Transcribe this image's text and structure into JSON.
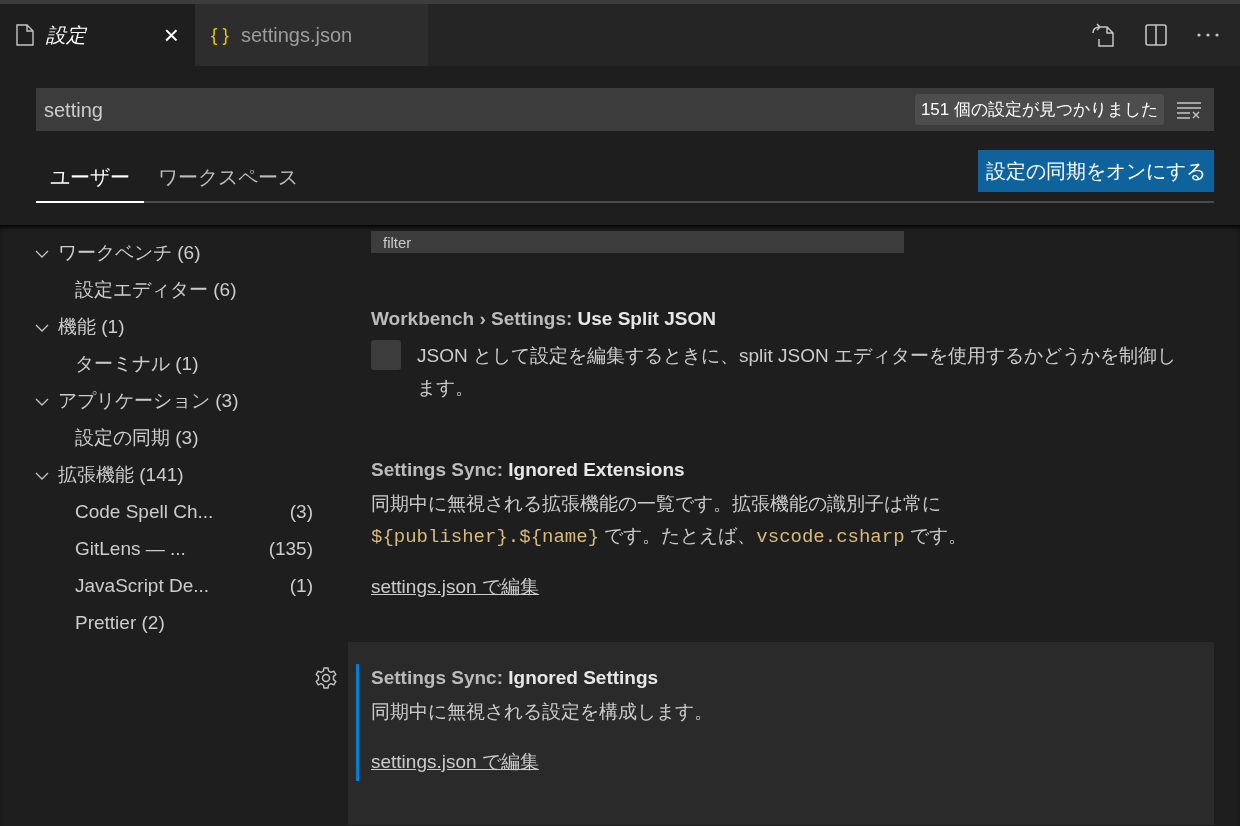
{
  "editor_tabs": [
    {
      "kind": "settings",
      "label": "設定",
      "selected": true,
      "close": "×"
    },
    {
      "kind": "json",
      "icon": "{ }",
      "label": "settings.json",
      "selected": false
    }
  ],
  "search": {
    "value": "setting",
    "result_count": "151 個の設定が見つかりました"
  },
  "scope_tabs": [
    {
      "label": "ユーザー",
      "selected": true
    },
    {
      "label": "ワークスペース",
      "selected": false
    }
  ],
  "sync_button": "設定の同期をオンにする",
  "toc": [
    {
      "label": "ワークベンチ (6)",
      "expanded": true,
      "children": [
        {
          "label": "設定エディター (6)"
        }
      ]
    },
    {
      "label": "機能 (1)",
      "expanded": true,
      "children": [
        {
          "label": "ターミナル (1)"
        }
      ]
    },
    {
      "label": "アプリケーション (3)",
      "expanded": true,
      "children": [
        {
          "label": "設定の同期 (3)"
        }
      ]
    },
    {
      "label": "拡張機能 (141)",
      "expanded": true,
      "children": [
        {
          "label": "Code Spell Ch...",
          "count": "(3)"
        },
        {
          "label": "GitLens — ...",
          "count": "(135)"
        },
        {
          "label": "JavaScript De...",
          "count": "(1)"
        },
        {
          "label": "Prettier (2)"
        }
      ]
    }
  ],
  "settings": [
    {
      "kind": "dropdown",
      "value": "filter"
    },
    {
      "kind": "checkbox",
      "category": "Workbench › Settings: ",
      "name": "Use Split JSON",
      "checked": false,
      "focused": false,
      "description": [
        {
          "text": "JSON として設定を編集するときに、split JSON エディターを使用するかどうかを制御します。",
          "code": false
        }
      ]
    },
    {
      "kind": "link",
      "category": "Settings Sync: ",
      "name": "Ignored Extensions",
      "focused": false,
      "description": [
        {
          "text": "同期中に無視される拡張機能の一覧です。拡張機能の識別子は常に ",
          "code": false
        },
        {
          "text": "${publisher}.${name}",
          "code": true
        },
        {
          "text": " です。たとえば、",
          "code": false
        },
        {
          "text": "vscode.csharp",
          "code": true
        },
        {
          "text": " です。",
          "code": false
        }
      ],
      "link": "settings.json で編集"
    },
    {
      "kind": "link",
      "category": "Settings Sync: ",
      "name": "Ignored Settings",
      "focused": true,
      "description": [
        {
          "text": "同期中に無視される設定を構成します。",
          "code": false
        }
      ],
      "link": "settings.json で編集"
    }
  ]
}
